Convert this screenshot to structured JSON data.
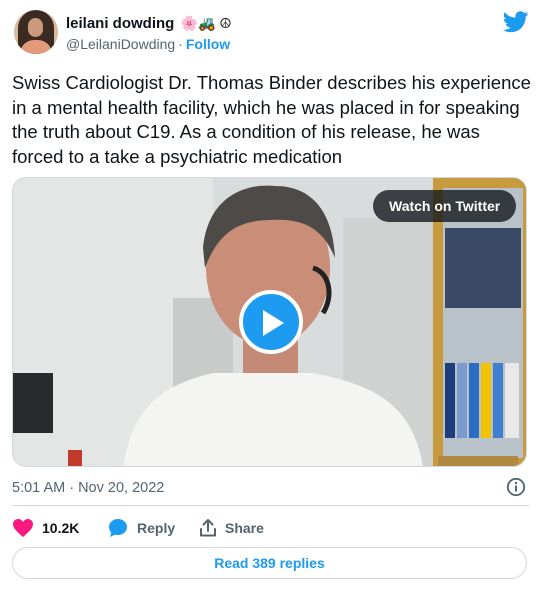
{
  "author": {
    "display_name": "leilani dowding",
    "name_emojis": "🌸🚜 ☮",
    "handle": "@LeilaniDowding",
    "separator": "·",
    "follow_label": "Follow"
  },
  "tweet": {
    "text": "Swiss Cardiologist Dr. Thomas Binder describes his experience in a mental health facility, which he was placed in for speaking the truth about C19. As a condition of his release, he was forced to a take a psychiatric medication",
    "timestamp": "5:01 AM · Nov 20, 2022"
  },
  "media": {
    "watch_label": "Watch on Twitter",
    "play_icon": "play-icon"
  },
  "actions": {
    "like_count": "10.2K",
    "reply_label": "Reply",
    "share_label": "Share"
  },
  "read_replies_label": "Read 389 replies",
  "colors": {
    "accent": "#1d9bf0",
    "like": "#f91880",
    "secondary_text": "#536471",
    "border": "#cfd9de"
  }
}
